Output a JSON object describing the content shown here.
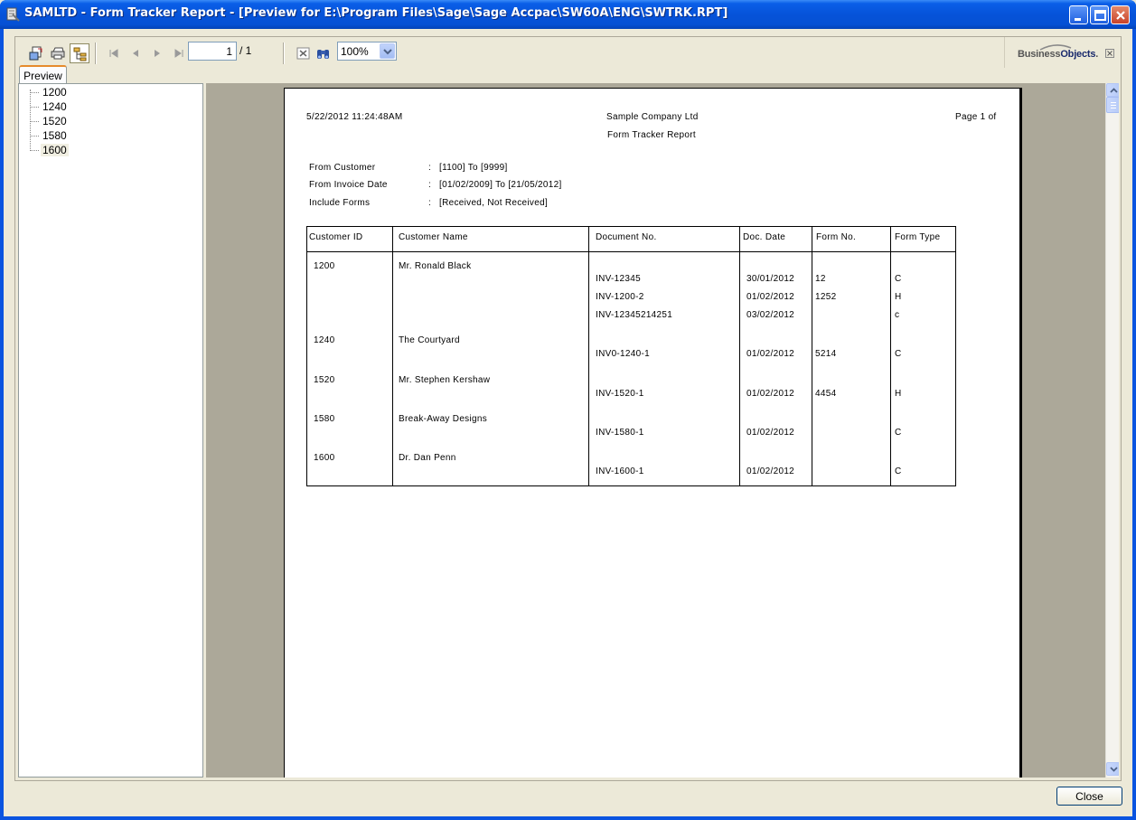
{
  "window": {
    "title": "SAMLTD - Form Tracker Report - [Preview for E:\\Program Files\\Sage\\Sage Accpac\\SW60A\\ENG\\SWTRK.RPT]"
  },
  "toolbar": {
    "page_current": "1",
    "page_total": "/ 1",
    "zoom": "100%",
    "brand_business": "Business",
    "brand_objects": "Objects",
    "brand_tm": "."
  },
  "tabs": [
    {
      "label": "Preview"
    }
  ],
  "tree": {
    "items": [
      "1200",
      "1240",
      "1520",
      "1580",
      "1600"
    ],
    "selected": "1600"
  },
  "report": {
    "timestamp": "5/22/2012  11:24:48AM",
    "company": "Sample Company Ltd",
    "title": "Form Tracker Report",
    "page_label": "Page 1 of",
    "criteria": [
      {
        "label": "From Customer",
        "sep": ":",
        "value": "[1100]  To  [9999]"
      },
      {
        "label": "From Invoice Date",
        "sep": ":",
        "value": "[01/02/2009] To [21/05/2012]"
      },
      {
        "label": "Include Forms",
        "sep": ":",
        "value": "[Received, Not Received]"
      }
    ],
    "columns": [
      "Customer ID",
      "Customer Name",
      "Document No.",
      "Doc. Date",
      "Form No.",
      "Form Type"
    ],
    "customers": [
      {
        "id": "1200",
        "name": "Mr. Ronald Black",
        "docs": [
          {
            "doc": "INV-12345",
            "date": "30/01/2012",
            "form_no": "12",
            "form_type": "C"
          },
          {
            "doc": "INV-1200-2",
            "date": "01/02/2012",
            "form_no": "1252",
            "form_type": "H"
          },
          {
            "doc": "INV-12345214251",
            "date": "03/02/2012",
            "form_no": "",
            "form_type": "c"
          }
        ]
      },
      {
        "id": "1240",
        "name": "The Courtyard",
        "docs": [
          {
            "doc": "INV0-1240-1",
            "date": "01/02/2012",
            "form_no": "5214",
            "form_type": "C"
          }
        ]
      },
      {
        "id": "1520",
        "name": "Mr. Stephen Kershaw",
        "docs": [
          {
            "doc": "INV-1520-1",
            "date": "01/02/2012",
            "form_no": "4454",
            "form_type": "H"
          }
        ]
      },
      {
        "id": "1580",
        "name": "Break-Away Designs",
        "docs": [
          {
            "doc": "INV-1580-1",
            "date": "01/02/2012",
            "form_no": "",
            "form_type": "C"
          }
        ]
      },
      {
        "id": "1600",
        "name": "Dr. Dan Penn",
        "docs": [
          {
            "doc": "INV-1600-1",
            "date": "01/02/2012",
            "form_no": "",
            "form_type": "C"
          }
        ]
      }
    ]
  },
  "buttons": {
    "close": "Close"
  }
}
